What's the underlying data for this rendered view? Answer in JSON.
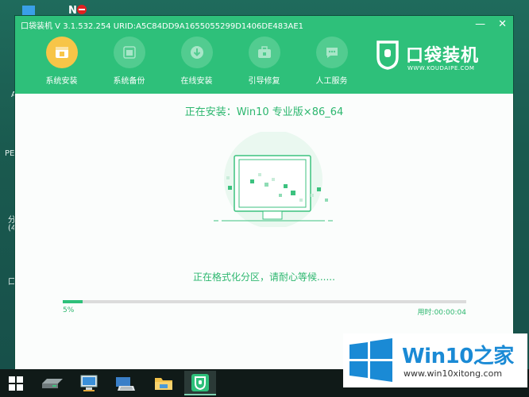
{
  "window": {
    "title": "口袋装机 V 3.1.532.254 URID:A5C84DD9A1655055299D1406DE483AE1",
    "minimize": "—",
    "close": "✕"
  },
  "nav": {
    "items": [
      {
        "label": "系统安装",
        "icon": "system-install-icon",
        "active": true
      },
      {
        "label": "系统备份",
        "icon": "system-backup-icon",
        "active": false
      },
      {
        "label": "在线安装",
        "icon": "online-install-icon",
        "active": false
      },
      {
        "label": "引导修复",
        "icon": "boot-repair-icon",
        "active": false
      },
      {
        "label": "人工服务",
        "icon": "support-chat-icon",
        "active": false
      }
    ]
  },
  "brand": {
    "name": "口袋装机",
    "url": "WWW.KOUDAIPE.COM"
  },
  "content": {
    "installing": "正在安装：Win10 专业版×86_64",
    "status": "正在格式化分区，请耐心等候......",
    "progress_percent": 5,
    "progress_label": "5%",
    "elapsed": "用时:00:00:04"
  },
  "desktop": {
    "labels": [
      "PE",
      "分",
      "(4",
      "口",
      "A"
    ]
  },
  "taskbar": {
    "items": [
      {
        "name": "start-icon"
      },
      {
        "name": "drive-icon"
      },
      {
        "name": "computer-icon"
      },
      {
        "name": "keyboard-icon"
      },
      {
        "name": "folder-icon"
      },
      {
        "name": "koudai-app-icon",
        "active": true
      }
    ]
  },
  "watermark": {
    "title": "Win10之家",
    "url": "www.win10xitong.com"
  },
  "colors": {
    "accent": "#2ec07a",
    "active_nav": "#f7c548",
    "text_green": "#2db76f"
  }
}
